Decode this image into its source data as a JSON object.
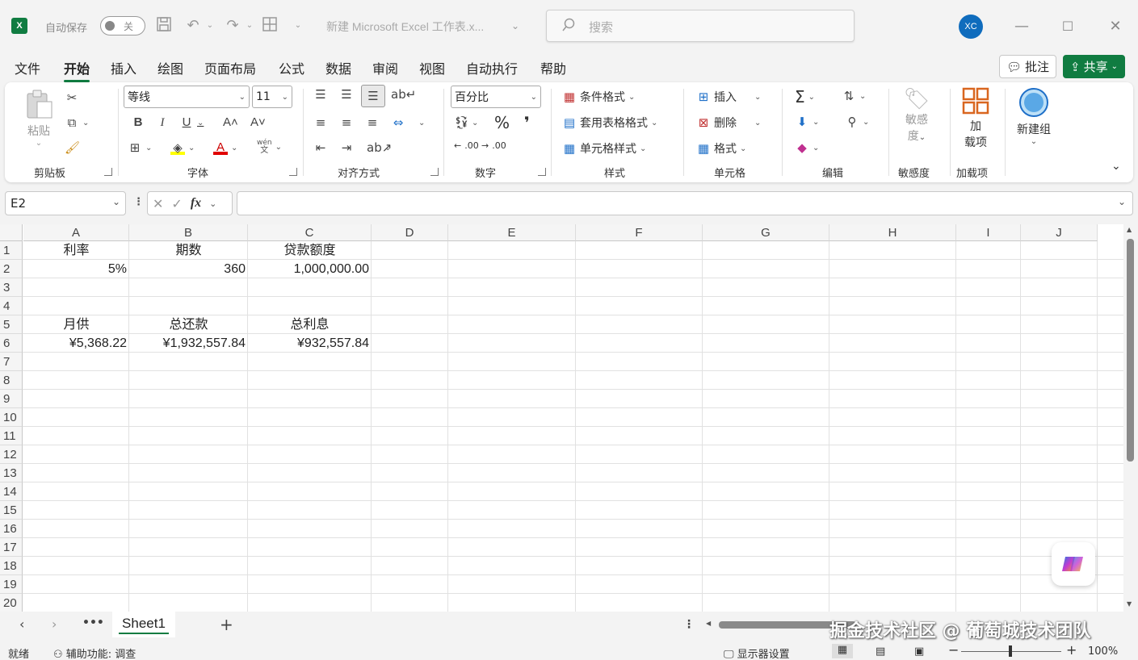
{
  "title_bar": {
    "app_logo_text": "X",
    "autosave_label": "自动保存",
    "autosave_state": "关",
    "doc_title": "新建 Microsoft Excel 工作表.x...",
    "search_placeholder": "搜索",
    "avatar_initials": "XC"
  },
  "tabs": [
    "文件",
    "开始",
    "插入",
    "绘图",
    "页面布局",
    "公式",
    "数据",
    "审阅",
    "视图",
    "自动执行",
    "帮助"
  ],
  "active_tab": "开始",
  "comments_label": "批注",
  "share_label": "共享",
  "ribbon": {
    "clipboard": {
      "paste": "粘贴",
      "group": "剪贴板"
    },
    "font": {
      "name": "等线",
      "size": "11",
      "group": "字体",
      "phonetic_top": "wén",
      "phonetic_bottom": "文"
    },
    "align": {
      "group": "对齐方式"
    },
    "number": {
      "format": "百分比",
      "group": "数字",
      "inc_decimal": ".00",
      "dec_decimal": ".00"
    },
    "styles": {
      "conditional": "条件格式",
      "table": "套用表格格式",
      "cell": "单元格样式",
      "group": "样式"
    },
    "cells": {
      "insert": "插入",
      "delete": "删除",
      "format": "格式",
      "group": "单元格"
    },
    "editing": {
      "group": "编辑"
    },
    "sensitivity": {
      "line1": "敏感",
      "line2": "度",
      "group": "敏感度"
    },
    "addins": {
      "line1": "加",
      "line2": "载项",
      "group": "加载项"
    },
    "newgroup": {
      "label": "新建组"
    }
  },
  "formula_bar": {
    "name_box": "E2",
    "fx": "fx",
    "value": ""
  },
  "grid": {
    "columns": [
      "A",
      "B",
      "C",
      "D",
      "E",
      "F",
      "G",
      "H",
      "I",
      "J"
    ],
    "rows": [
      "1",
      "2",
      "3",
      "4",
      "5",
      "6",
      "7",
      "8",
      "9",
      "10",
      "11",
      "12",
      "13",
      "14",
      "15",
      "16",
      "17",
      "18",
      "19",
      "20"
    ],
    "cells": {
      "A1": "利率",
      "B1": "期数",
      "C1": "贷款额度",
      "A2": "5%",
      "B2": "360",
      "C2": "1,000,000.00",
      "A5": "月供",
      "B5": "总还款",
      "C5": "总利息",
      "A6": "¥5,368.22",
      "B6": "¥1,932,557.84",
      "C6": "¥932,557.84"
    }
  },
  "sheets": {
    "active": "Sheet1"
  },
  "watermark": "掘金技术社区 @ 葡萄城技术团队",
  "status": {
    "ready": "就绪",
    "accessibility": "辅助功能: 调查",
    "display_settings": "显示器设置",
    "zoom": "100%"
  },
  "colors": {
    "accent": "#107c41",
    "avatar": "#0f6cbd"
  }
}
